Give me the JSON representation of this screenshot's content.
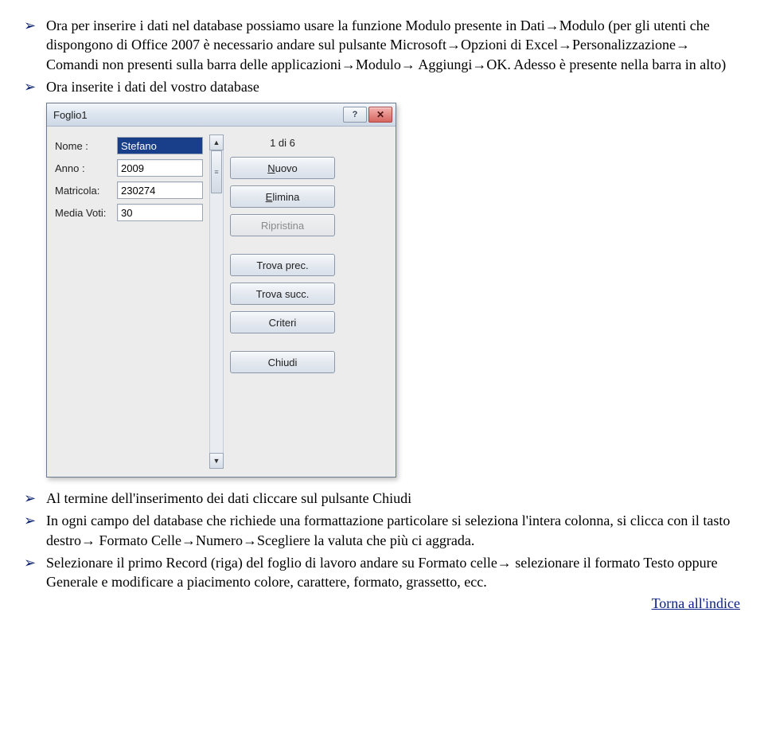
{
  "bullets": {
    "b1": "Ora per inserire i dati nel database possiamo usare la funzione Modulo presente in Dati→Modulo (per gli utenti che dispongono di Office 2007 è necessario andare sul pulsante Microsoft→Opzioni di Excel→Personalizzazione→ Comandi non presenti sulla barra delle applicazioni→Modulo→ Aggiungi→OK. Adesso è presente nella barra in alto)",
    "b2": "Ora inserite i dati del vostro database",
    "b3": "Al termine dell'inserimento dei dati cliccare sul pulsante Chiudi",
    "b4": "In ogni campo del database che richiede una formattazione particolare si seleziona l'intera colonna, si clicca con il tasto destro→ Formato Celle→Numero→Scegliere la valuta che più ci aggrada.",
    "b5": "Selezionare il primo Record (riga) del foglio di lavoro andare su Formato celle→ selezionare il formato Testo oppure Generale e modificare a piacimento colore, carattere, formato, grassetto, ecc."
  },
  "dialog": {
    "title": "Foglio1",
    "counter": "1 di 6",
    "fields": {
      "nome_label": "Nome :",
      "nome_value": "Stefano",
      "anno_label": "Anno :",
      "anno_value": "2009",
      "matricola_label": "Matricola:",
      "matricola_value": "230274",
      "media_label": "Media Voti:",
      "media_value": "30"
    },
    "buttons": {
      "nuovo": "Nuovo",
      "elimina": "Elimina",
      "ripristina": "Ripristina",
      "trova_prec": "Trova prec.",
      "trova_succ": "Trova succ.",
      "criteri": "Criteri",
      "chiudi": "Chiudi"
    }
  },
  "footer_link": "Torna all'indice"
}
